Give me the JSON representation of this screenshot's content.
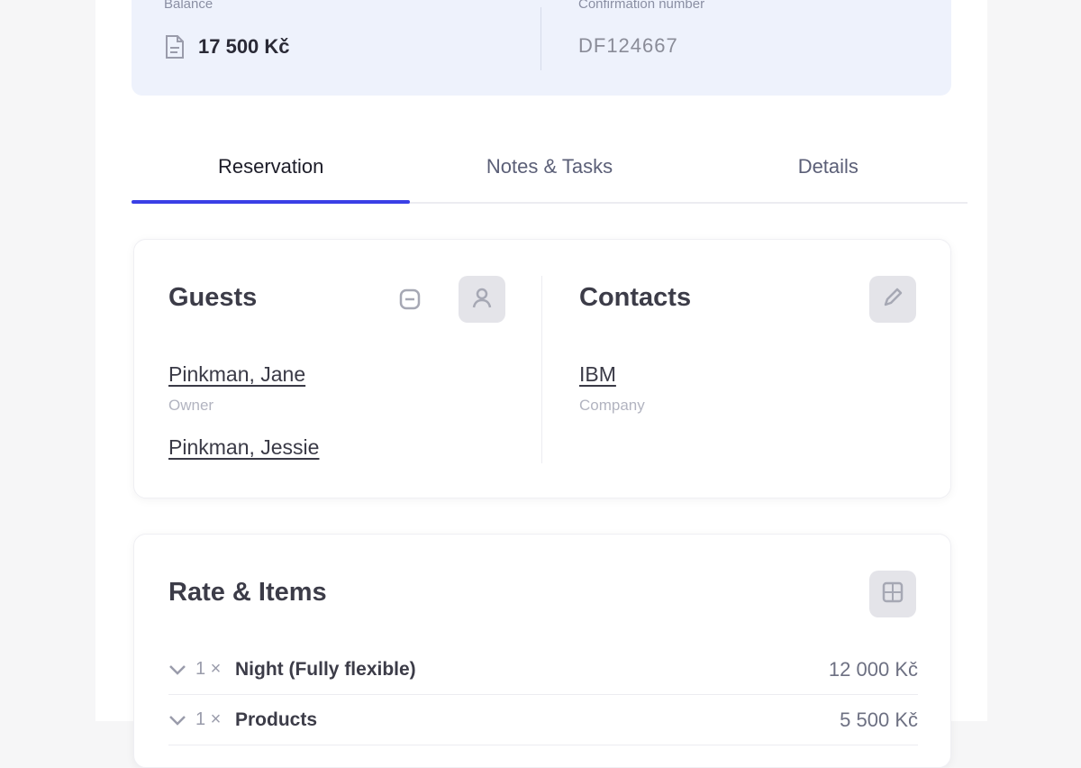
{
  "summary": {
    "balance_label": "Balance",
    "balance_value": "17 500 Kč",
    "confirmation_label": "Confirmation number",
    "confirmation_value": "DF124667"
  },
  "tabs": [
    {
      "label": "Reservation",
      "active": true
    },
    {
      "label": "Notes & Tasks",
      "active": false
    },
    {
      "label": "Details",
      "active": false
    }
  ],
  "guests": {
    "title": "Guests",
    "items": [
      {
        "name": "Pinkman, Jane",
        "role": "Owner"
      },
      {
        "name": "Pinkman, Jessie",
        "role": ""
      }
    ]
  },
  "contacts": {
    "title": "Contacts",
    "items": [
      {
        "name": "IBM",
        "role": "Company"
      }
    ]
  },
  "rates": {
    "title": "Rate & Items",
    "rows": [
      {
        "qty": "1 ×",
        "name": "Night (Fully flexible)",
        "amount": "12 000 Kč"
      },
      {
        "qty": "1 ×",
        "name": "Products",
        "amount": "5 500 Kč"
      }
    ]
  },
  "icons": {
    "balance": "document-icon",
    "guest_info": "info-square-icon",
    "add_guest": "person-icon",
    "edit_contacts": "pencil-icon",
    "rates_menu": "grid-icon",
    "expand": "chevron-down-icon"
  },
  "colors": {
    "accent": "#3a3fe6",
    "summary_bg": "#eef2fc"
  }
}
